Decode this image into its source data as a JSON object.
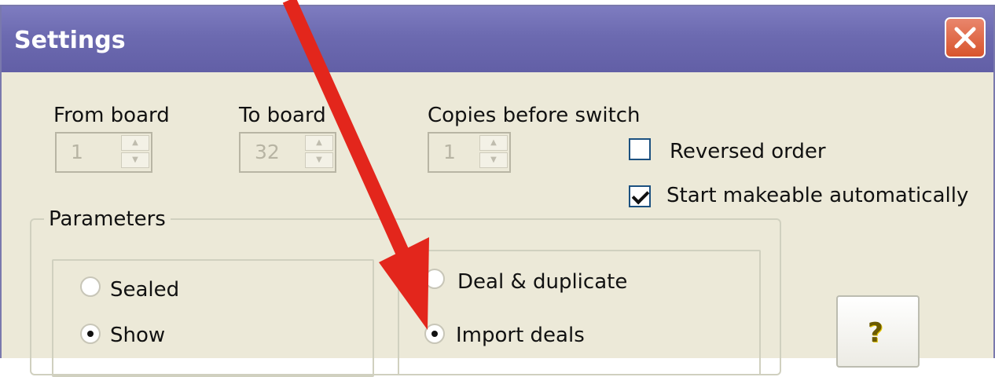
{
  "window": {
    "title": "Settings"
  },
  "range": {
    "from_label": "From board",
    "from_value": "1",
    "to_label": "To board",
    "to_value": "32",
    "copies_label": "Copies before switch",
    "copies_value": "1"
  },
  "options": {
    "reversed_label": "Reversed order",
    "reversed_checked": false,
    "makeable_label": "Start makeable automatically",
    "makeable_checked": true
  },
  "parameters": {
    "legend": "Parameters",
    "visibility": [
      {
        "label": "Sealed",
        "selected": false
      },
      {
        "label": "Show",
        "selected": true
      }
    ],
    "source": [
      {
        "label": "Deal & duplicate",
        "selected": false
      },
      {
        "label": "Import deals",
        "selected": true
      }
    ]
  },
  "help": {
    "icon": "question-mark-icon",
    "glyph": "?"
  },
  "annotation": {
    "arrow_color": "#e3261c"
  },
  "colors": {
    "titlebar": "#6c6ab0",
    "dialog_bg": "#ece9d8",
    "close_btn": "#d8542d"
  }
}
